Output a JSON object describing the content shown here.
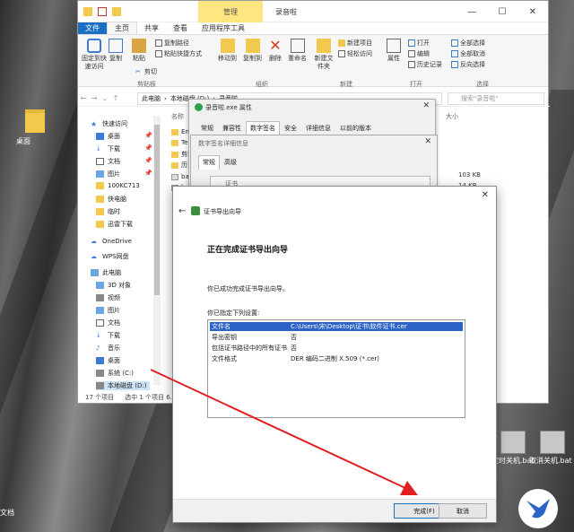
{
  "desktop": {
    "folder_label": "桌面",
    "left_partial_label": "文档",
    "bats": [
      {
        "label": "定时关机.bat"
      },
      {
        "label": "取消关机.bat"
      }
    ]
  },
  "explorer": {
    "context_tab": "管理",
    "window_title": "录音啦",
    "tabs": [
      "文件",
      "主页",
      "共享",
      "查看",
      "应用程序工具"
    ],
    "ribbon": {
      "clipboard": {
        "pin_label": "固定到快速访问",
        "copy_label": "复制",
        "paste_label": "粘贴",
        "copy_path": "复制路径",
        "paste_shortcut": "粘贴快捷方式",
        "cut": "剪切",
        "group": "剪贴板"
      },
      "organize": {
        "move_to": "移动到",
        "copy_to": "复制到",
        "delete": "删除",
        "rename": "重命名",
        "group": "组织"
      },
      "new": {
        "new_folder": "新建文件夹",
        "new_item": "新建项目",
        "easy_access": "轻松访问",
        "group": "新建"
      },
      "open": {
        "properties": "属性",
        "open": "打开",
        "edit": "编辑",
        "history": "历史记录",
        "group": "打开"
      },
      "select": {
        "select_all": "全部选择",
        "select_none": "全部取消",
        "invert": "反向选择",
        "group": "选择"
      }
    },
    "address": {
      "path": [
        "此电脑",
        "本地磁盘 (D:)",
        "录音啦"
      ],
      "search_placeholder": "搜索\"录音啦\""
    },
    "nav": {
      "quick_access": "快速访问",
      "items": [
        "桌面",
        "下载",
        "文档",
        "图片",
        "100KC713",
        "快电脑",
        "临时",
        "迅雷下载"
      ],
      "onedrive": "OneDrive",
      "wps": "WPS网盘",
      "this_pc": "此电脑",
      "pc_items": [
        "3D 对象",
        "视频",
        "图片",
        "文档",
        "下载",
        "音乐",
        "桌面",
        "系统 (C:)",
        "本地磁盘 (D:)"
      ]
    },
    "columns": {
      "name": "名称",
      "size": "大小"
    },
    "files": [
      "En",
      "Ter",
      "剪辑",
      "历史",
      "bat",
      "bat"
    ],
    "sizes": [
      "103 KB",
      "14 KB"
    ],
    "status": {
      "count": "17 个项目",
      "selected": "选中 1 个项目 6."
    }
  },
  "properties": {
    "title": "录音啦.exe 属性",
    "tabs": [
      "常规",
      "兼容性",
      "数字签名",
      "安全",
      "详细信息",
      "以前的版本"
    ]
  },
  "signature_details": {
    "title": "数字签名详细信息",
    "tabs": [
      "常规",
      "高级"
    ],
    "cert_partial": "证书"
  },
  "wizard": {
    "title": "证书导出向导",
    "heading": "正在完成证书导出向导",
    "message": "你已成功完成证书导出向导。",
    "specified": "你已指定下列设置:",
    "rows": [
      {
        "key": "文件名",
        "value": "C:\\Users\\宋\\Desktop\\证书\\软件证书.cer"
      },
      {
        "key": "导出密钥",
        "value": "否"
      },
      {
        "key": "包括证书路径中的所有证书",
        "value": "否"
      },
      {
        "key": "文件格式",
        "value": "DER 编码二进制 X.509 (*.cer)"
      }
    ],
    "finish_button": "完成(F)",
    "cancel_button": "取消"
  },
  "colors": {
    "accent": "#1a6fc4",
    "selection": "#2b63c6",
    "arrow": "#e02020",
    "context_tab": "#ffe680"
  }
}
